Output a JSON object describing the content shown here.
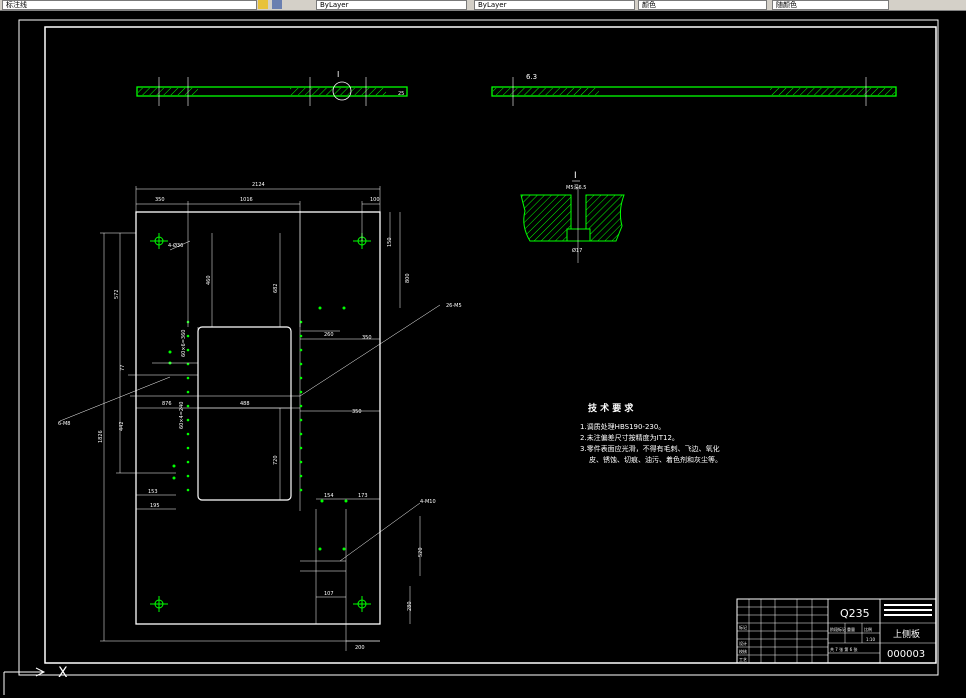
{
  "toolbar": {
    "fields": [
      "标注线",
      "ByLayer",
      "ByLayer",
      "颜色",
      "随颜色"
    ],
    "icon": "layer-icon"
  },
  "drawing": {
    "section_label": "I",
    "section_label_right": "6.3",
    "detail_label": "I",
    "detail_top_dim": "M5深6.5",
    "detail_bottom_dim": "Ø17",
    "dims": {
      "overall_width": "2124",
      "left_offset": "350",
      "span_top": "1016",
      "hole_right": "100",
      "hole_down": "150",
      "left_height_top": "572",
      "height_460": "460",
      "height_682": "682",
      "height_800": "800",
      "side_left_77": "77",
      "total_height": "1826",
      "left_lower": "442",
      "offset_876": "876",
      "center_488": "488",
      "window_height": "720",
      "right_260": "260",
      "right_350": "350",
      "right_350b": "350",
      "bolt_pitch": "60×6=360",
      "bolt_pitch2": "60×4=240",
      "bottom_153": "153",
      "bottom_195": "195",
      "bottom_154": "154",
      "bottom_173": "173",
      "bottom_107": "107",
      "bottom_200": "200",
      "right_520": "520",
      "right_280": "280",
      "hole_label_top": "4-Ø36",
      "hole_label_m8": "6-M8",
      "hole_label_m5": "26-M5",
      "hole_label_m10": "4-M10",
      "plate_thk": "25"
    },
    "tech": {
      "title": "技 术 要 求",
      "lines": [
        "1.调质处理HBS190-230。",
        "2.未注偏差尺寸按精度为IT12。",
        "3.零件表面应光滑，不得有毛刺、飞边、氧化",
        "皮、锈蚀、切痕、油污、着色剂和灰尘等。"
      ]
    },
    "title_block": {
      "material": "Q235",
      "part_name": "上侧板",
      "drawing_no": "000003",
      "scale": "1:10",
      "sheet": "共 7 张  第 6 张",
      "row_labels": [
        "标记",
        "设计",
        "校核",
        "工艺"
      ],
      "col_labels": [
        "阶段标记",
        "重量",
        "比例"
      ]
    },
    "ucs_label": "X"
  },
  "colors": {
    "background": "#000000",
    "lines": "#ffffff",
    "green": "#00ff00",
    "toolbar": "#d4d0c8"
  }
}
